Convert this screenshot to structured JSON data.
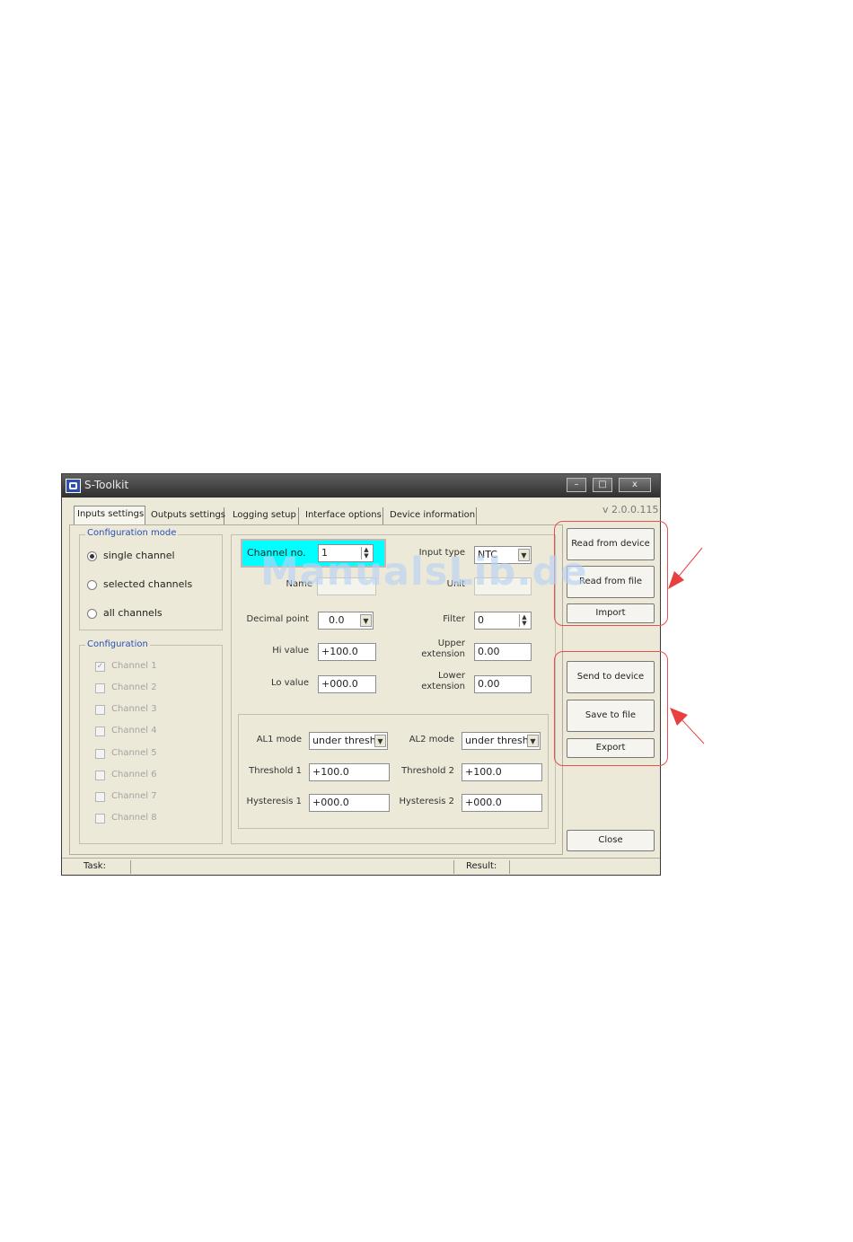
{
  "window": {
    "title": "S-Toolkit",
    "version": "v 2.0.0.115",
    "controls": {
      "minimize": "–",
      "maximize": "□",
      "close": "x"
    }
  },
  "tabs": [
    {
      "label": "Inputs settings",
      "active": true
    },
    {
      "label": "Outputs settings",
      "active": false
    },
    {
      "label": "Logging setup",
      "active": false
    },
    {
      "label": "Interface options",
      "active": false
    },
    {
      "label": "Device information",
      "active": false
    }
  ],
  "config_mode": {
    "title": "Configuration mode",
    "options": [
      {
        "label": "single channel",
        "selected": true
      },
      {
        "label": "selected channels",
        "selected": false
      },
      {
        "label": "all channels",
        "selected": false
      }
    ]
  },
  "configuration": {
    "title": "Configuration",
    "channels": [
      {
        "label": "Channel 1",
        "checked": true
      },
      {
        "label": "Channel 2",
        "checked": false
      },
      {
        "label": "Channel 3",
        "checked": false
      },
      {
        "label": "Channel 4",
        "checked": false
      },
      {
        "label": "Channel 5",
        "checked": false
      },
      {
        "label": "Channel 6",
        "checked": false
      },
      {
        "label": "Channel 7",
        "checked": false
      },
      {
        "label": "Channel 8",
        "checked": false
      }
    ]
  },
  "settings": {
    "channel_no_label": "Channel no.",
    "channel_no_value": "1",
    "input_type_label": "Input type",
    "input_type_value": "NTC",
    "name_label": "Name",
    "name_value": "",
    "unit_label": "Unit",
    "unit_value": "",
    "decimal_point_label": "Decimal point",
    "decimal_point_value": "0.0",
    "filter_label": "Filter",
    "filter_value": "0",
    "hi_value_label": "Hi value",
    "hi_value_value": "+100.0",
    "upper_extension_label": "Upper extension",
    "upper_extension_value": "0.00",
    "lo_value_label": "Lo value",
    "lo_value_value": "+000.0",
    "lower_extension_label": "Lower extension",
    "lower_extension_value": "0.00"
  },
  "alarms": {
    "al1_mode_label": "AL1 mode",
    "al1_mode_value": "under thresh..",
    "al2_mode_label": "AL2 mode",
    "al2_mode_value": "under thresh..",
    "threshold1_label": "Threshold 1",
    "threshold1_value": "+100.0",
    "threshold2_label": "Threshold 2",
    "threshold2_value": "+100.0",
    "hysteresis1_label": "Hysteresis 1",
    "hysteresis1_value": "+000.0",
    "hysteresis2_label": "Hysteresis 2",
    "hysteresis2_value": "+000.0"
  },
  "actions": {
    "read_from_device": "Read from device",
    "read_from_file": "Read from file",
    "import": "Import",
    "send_to_device": "Send to device",
    "save_to_file": "Save to file",
    "export": "Export",
    "close": "Close"
  },
  "statusbar": {
    "task_label": "Task:",
    "result_label": "Result:"
  },
  "watermark": "ManualsLib.de",
  "colors": {
    "title_bar": "#3f3f3f",
    "channel_highlight": "#00ffff",
    "group_label": "#2a4fb8",
    "annotation": "#e84040"
  }
}
